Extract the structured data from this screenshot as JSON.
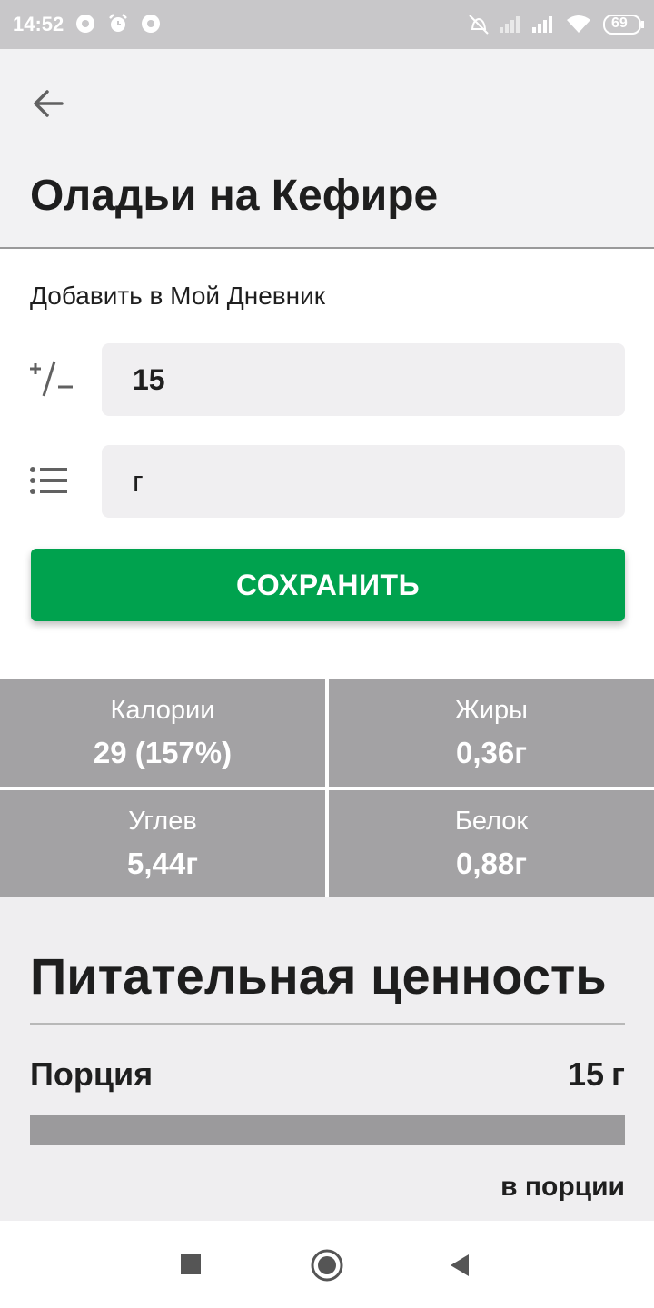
{
  "status_bar": {
    "time": "14:52",
    "battery": "69",
    "icons": [
      "chrome-icon",
      "alarm-icon",
      "chrome-icon",
      "mute-icon",
      "signal-icon",
      "signal-icon",
      "wifi-icon",
      "battery-icon"
    ]
  },
  "header": {
    "title": "Оладьи на Кефире",
    "back_icon": "arrow-back-icon"
  },
  "add_section": {
    "label": "Добавить в Мой Дневник",
    "quantity_icon": "plus-minus-icon",
    "quantity_value": "15",
    "unit_icon": "list-icon",
    "unit_value": "г",
    "save_label": "СОХРАНИТЬ",
    "accent": "#00a24e"
  },
  "macros": [
    {
      "label": "Калории",
      "value": "29 (157%)"
    },
    {
      "label": "Жиры",
      "value": "0,36г"
    },
    {
      "label": "Углев",
      "value": "5,44г"
    },
    {
      "label": "Белок",
      "value": "0,88г"
    }
  ],
  "nutrition": {
    "title": "Питательная ценность",
    "portion_label": "Порция",
    "portion_amount": "15",
    "portion_unit": "г",
    "per_portion_label": "в порции"
  },
  "nav": {
    "icons": [
      "recents-square-icon",
      "home-circle-icon",
      "back-triangle-icon"
    ]
  }
}
